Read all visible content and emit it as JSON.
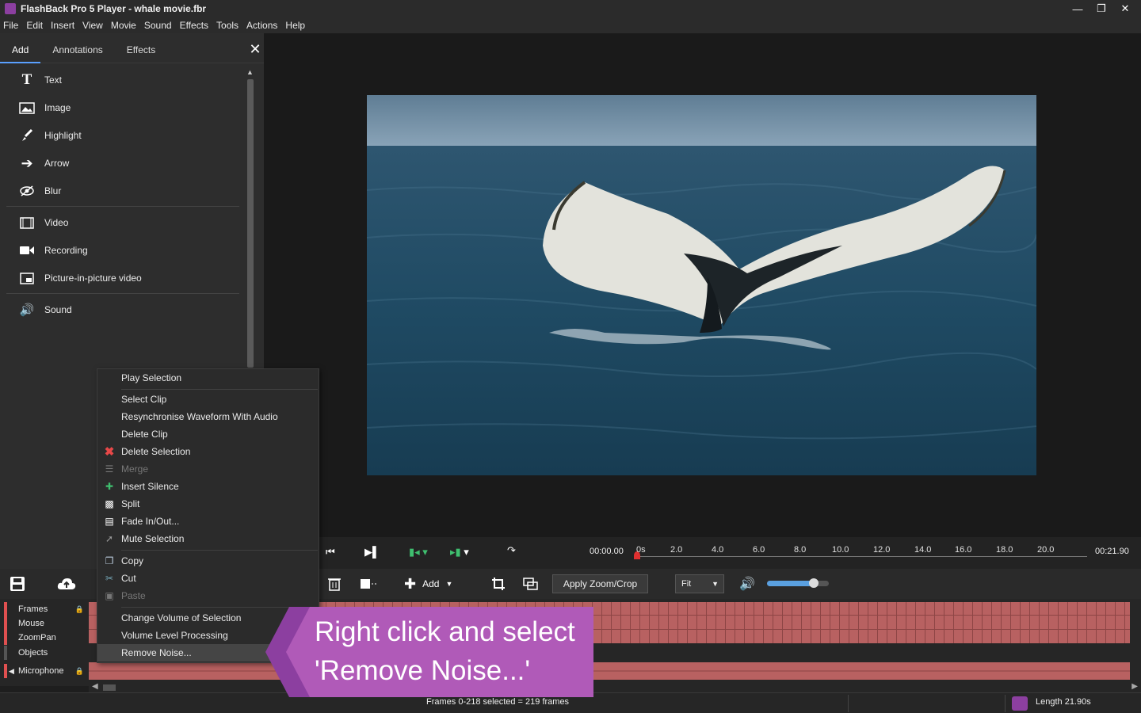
{
  "window": {
    "title": "FlashBack Pro 5 Player - whale movie.fbr",
    "controls": [
      "minimize-icon",
      "restore-icon",
      "close-icon"
    ]
  },
  "menu": [
    "File",
    "Edit",
    "Insert",
    "View",
    "Movie",
    "Sound",
    "Effects",
    "Tools",
    "Actions",
    "Help"
  ],
  "panel": {
    "tabs": [
      {
        "label": "Add",
        "active": true
      },
      {
        "label": "Annotations",
        "active": false
      },
      {
        "label": "Effects",
        "active": false
      }
    ],
    "items": [
      {
        "icon": "text-icon",
        "label": "Text"
      },
      {
        "icon": "image-icon",
        "label": "Image"
      },
      {
        "icon": "highlight-icon",
        "label": "Highlight"
      },
      {
        "icon": "arrow-icon",
        "label": "Arrow"
      },
      {
        "icon": "blur-icon",
        "label": "Blur"
      },
      {
        "icon": "video-icon",
        "label": "Video"
      },
      {
        "icon": "recording-icon",
        "label": "Recording"
      },
      {
        "icon": "pip-icon",
        "label": "Picture-in-picture video"
      },
      {
        "icon": "sound-icon",
        "label": "Sound"
      }
    ]
  },
  "timeline": {
    "current_time": "00:00.00",
    "end_time": "00:21.90",
    "ticks": [
      "0s",
      "2.0",
      "4.0",
      "6.0",
      "8.0",
      "10.0",
      "12.0",
      "14.0",
      "16.0",
      "18.0",
      "20.0"
    ]
  },
  "toolbar": {
    "add_label": "Add",
    "apply_zoom_label": "Apply Zoom/Crop",
    "fit_value": "Fit",
    "volume_level": 0.75
  },
  "tracks": [
    "Frames",
    "Mouse",
    "ZoomPan",
    "Objects",
    "Microphone"
  ],
  "context_menu": {
    "items": [
      {
        "label": "Play Selection",
        "icon": "",
        "disabled": false
      },
      {
        "label": "Select Clip",
        "icon": "",
        "disabled": false
      },
      {
        "label": "Resynchronise Waveform With Audio",
        "icon": "",
        "disabled": false
      },
      {
        "label": "Delete Clip",
        "icon": "",
        "disabled": false
      },
      {
        "label": "Delete Selection",
        "icon": "delete-x-icon",
        "disabled": false
      },
      {
        "label": "Merge",
        "icon": "merge-icon",
        "disabled": true
      },
      {
        "label": "Insert Silence",
        "icon": "insert-silence-icon",
        "disabled": false
      },
      {
        "label": "Split",
        "icon": "split-icon",
        "disabled": false
      },
      {
        "label": "Fade In/Out...",
        "icon": "fade-icon",
        "disabled": false
      },
      {
        "label": "Mute Selection",
        "icon": "mute-icon",
        "disabled": false
      },
      {
        "label": "Copy",
        "icon": "copy-icon",
        "disabled": false
      },
      {
        "label": "Cut",
        "icon": "cut-icon",
        "disabled": false
      },
      {
        "label": "Paste",
        "icon": "paste-icon",
        "disabled": true
      },
      {
        "label": "Change Volume of Selection",
        "icon": "",
        "disabled": false
      },
      {
        "label": "Volume Level Processing",
        "icon": "",
        "disabled": false
      },
      {
        "label": "Remove Noise...",
        "icon": "",
        "disabled": false,
        "highlighted": true
      }
    ]
  },
  "callout": {
    "line1": "Right click and select",
    "line2": "'Remove Noise...'",
    "color": "#b05ab8"
  },
  "status": {
    "selection": "Frames 0-218 selected = 219 frames",
    "length": "Length 21.90s"
  },
  "colors": {
    "accent": "#5aa0ff",
    "track_fill": "#b86161",
    "playhead": "#e03030"
  }
}
